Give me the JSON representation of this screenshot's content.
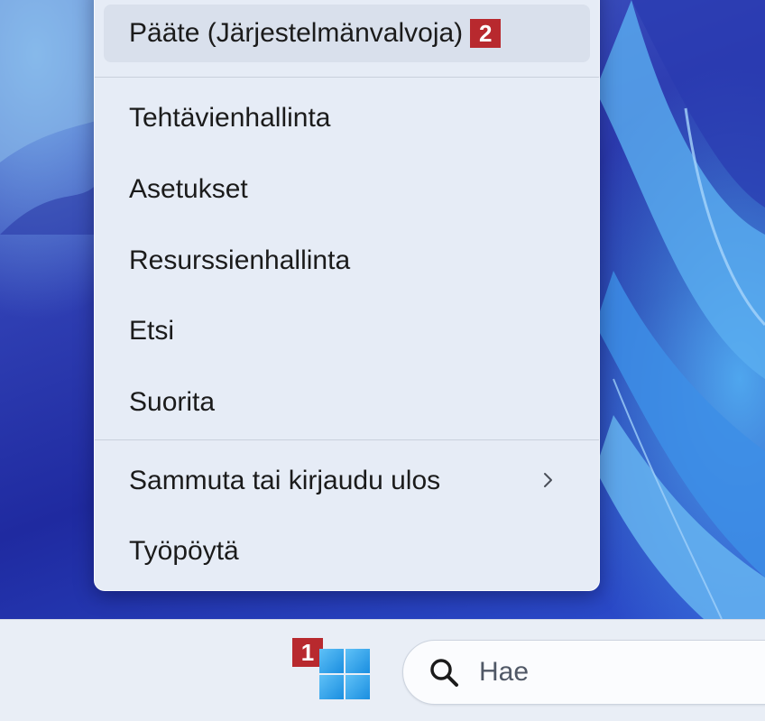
{
  "context_menu": {
    "items": [
      {
        "label": "Pääte (Järjestelmänvalvoja)",
        "badge": "2"
      },
      {
        "label": "Tehtävienhallinta"
      },
      {
        "label": "Asetukset"
      },
      {
        "label": "Resurssienhallinta"
      },
      {
        "label": "Etsi"
      },
      {
        "label": "Suorita"
      },
      {
        "label": "Sammuta tai kirjaudu ulos"
      },
      {
        "label": "Työpöytä"
      }
    ]
  },
  "taskbar": {
    "start_badge": "1",
    "search_placeholder": "Hae"
  },
  "colors": {
    "badge": "#b8292e",
    "menu_background": "#e6ecf6",
    "taskbar_background": "#e9eef6",
    "windows_logo": "#1a8ee0"
  },
  "icons": [
    "chevron-right-icon",
    "windows-start-icon",
    "search-icon"
  ]
}
